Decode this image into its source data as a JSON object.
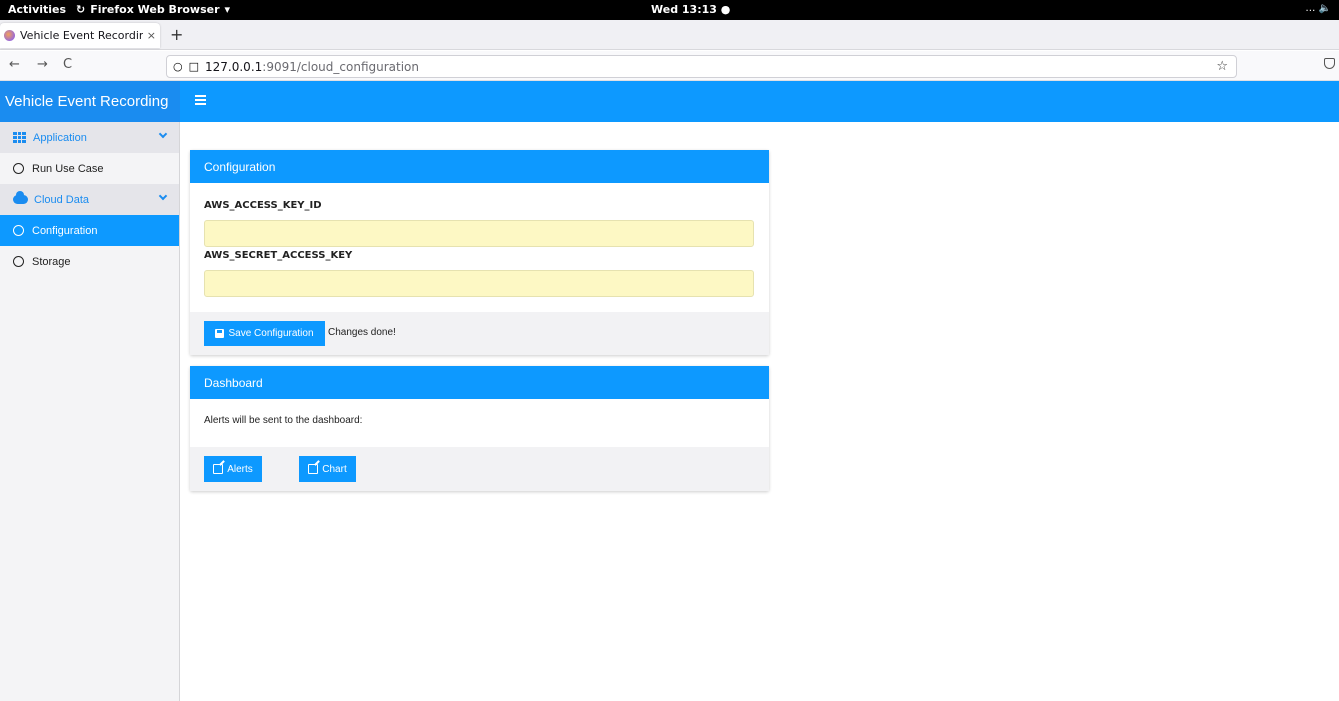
{
  "os_bar": {
    "activities": "Activities",
    "app_name": "Firefox Web Browser",
    "clock": "Wed 13:13 ●",
    "tray": "… 🔈"
  },
  "browser": {
    "tab_title": "Vehicle Event Recordin",
    "tab_close": "×",
    "new_tab": "+",
    "back": "←",
    "forward": "→",
    "reload": "C",
    "url_host": "127.0.0.1",
    "url_path": ":9091/cloud_configuration",
    "bookmark_star": "☆"
  },
  "app": {
    "brand": "Vehicle Event Recording"
  },
  "sidebar": {
    "items": [
      {
        "label": "Application",
        "kind": "group"
      },
      {
        "label": "Run Use Case",
        "kind": "item"
      },
      {
        "label": "Cloud Data",
        "kind": "group"
      },
      {
        "label": "Configuration",
        "kind": "item",
        "active": true
      },
      {
        "label": "Storage",
        "kind": "item"
      }
    ]
  },
  "config_card": {
    "title": "Configuration",
    "field1_label": "AWS_ACCESS_KEY_ID",
    "field1_value": "",
    "field2_label": "AWS_SECRET_ACCESS_KEY",
    "field2_value": "",
    "save_label": "Save Configuration",
    "status": "Changes done!"
  },
  "dashboard_card": {
    "title": "Dashboard",
    "text": "Alerts will be sent to the dashboard:",
    "alerts_label": "Alerts",
    "chart_label": "Chart"
  },
  "colors": {
    "accent": "#0d99ff",
    "input_bg": "#fdf8c4"
  }
}
